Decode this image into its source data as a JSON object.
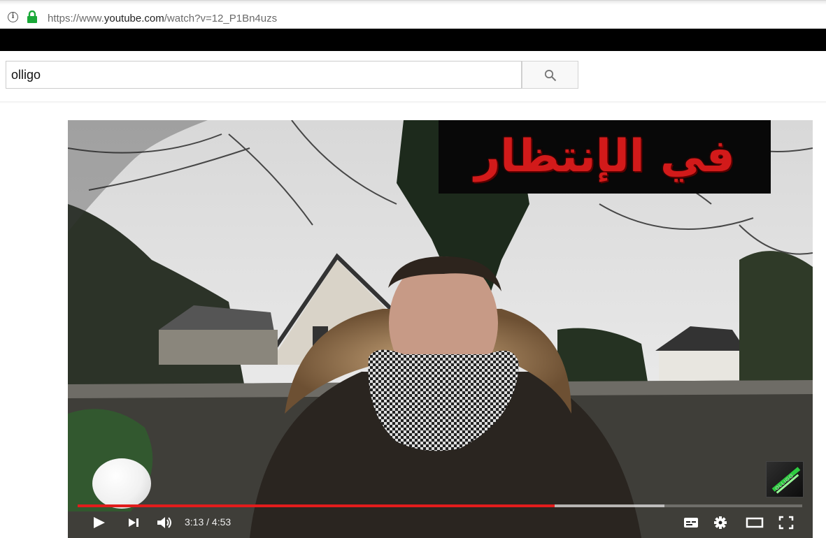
{
  "browser": {
    "url_prefix": "https://www.",
    "url_domain": "youtube.com",
    "url_path": "/watch?v=12_P1Bn4uzs"
  },
  "search": {
    "query": "olligo",
    "button_icon": "search-icon"
  },
  "video": {
    "title_overlay": "في الإنتظار",
    "channel_logo_text": "OLLIGO",
    "current_time": "3:13",
    "duration": "4:53",
    "time_display": "3:13 / 4:53",
    "played_fraction": 0.658,
    "buffered_fraction": 0.81
  },
  "player_controls": {
    "left": [
      "play-icon",
      "next-icon",
      "volume-icon"
    ],
    "right": [
      "subtitles-icon",
      "settings-icon",
      "theater-mode-icon",
      "fullscreen-icon"
    ]
  },
  "colors": {
    "progress_played": "#e21c1c",
    "title_text": "#d21a1a",
    "lock_green": "#1aa838"
  }
}
